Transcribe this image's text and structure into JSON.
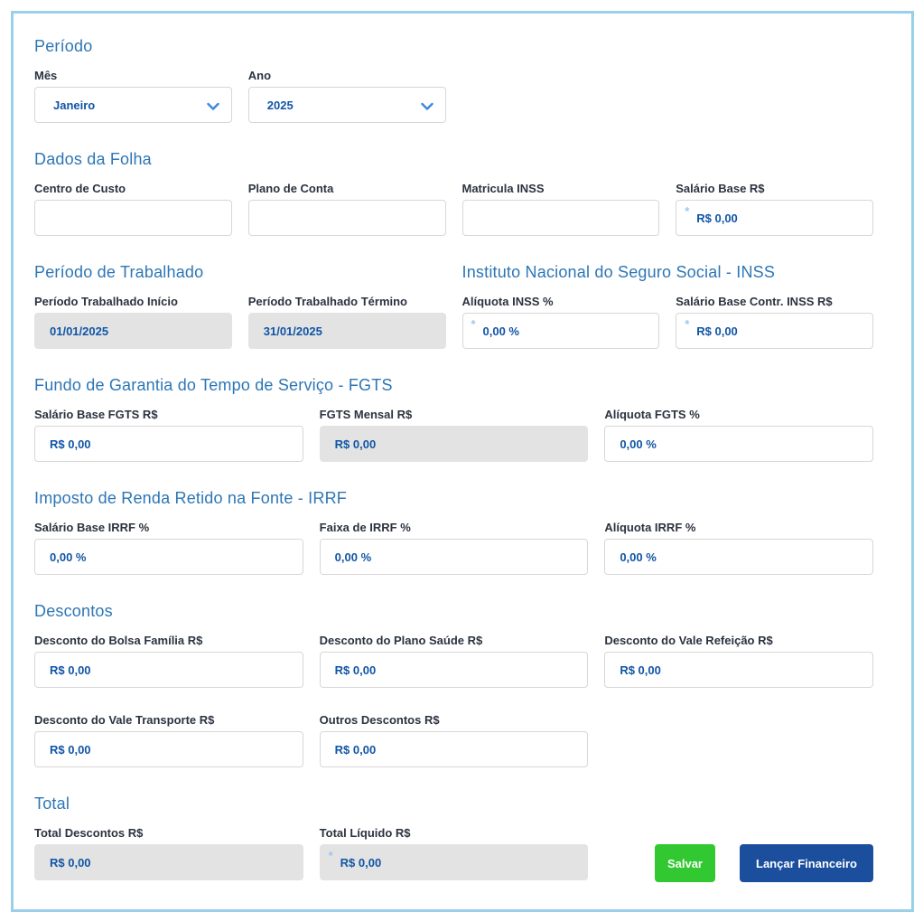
{
  "sections": {
    "periodo": {
      "title": "Período"
    },
    "dados_folha": {
      "title": "Dados da Folha"
    },
    "periodo_trabalhado": {
      "title": "Período de Trabalhado"
    },
    "inss": {
      "title": "Instituto Nacional do Seguro Social - INSS"
    },
    "fgts": {
      "title": "Fundo de Garantia do Tempo de Serviço - FGTS"
    },
    "irrf": {
      "title": "Imposto de Renda Retido na Fonte - IRRF"
    },
    "descontos": {
      "title": "Descontos"
    },
    "total": {
      "title": "Total"
    }
  },
  "fields": {
    "mes": {
      "label": "Mês",
      "value": "Janeiro"
    },
    "ano": {
      "label": "Ano",
      "value": "2025"
    },
    "centro_custo": {
      "label": "Centro de Custo",
      "value": ""
    },
    "plano_conta": {
      "label": "Plano de Conta",
      "value": ""
    },
    "matricula_inss": {
      "label": "Matricula INSS",
      "value": ""
    },
    "salario_base": {
      "label": "Salário Base R$",
      "value": "R$ 0,00",
      "required": "*"
    },
    "periodo_inicio": {
      "label": "Período Trabalhado Início",
      "value": "01/01/2025"
    },
    "periodo_termino": {
      "label": "Período Trabalhado Término",
      "value": "31/01/2025"
    },
    "aliquota_inss": {
      "label": "Alíquota INSS %",
      "value": "0,00 %",
      "required": "*"
    },
    "salario_base_contr_inss": {
      "label": "Salário Base Contr. INSS R$",
      "value": "R$ 0,00",
      "required": "*"
    },
    "salario_base_fgts": {
      "label": "Salário Base FGTS R$",
      "value": "R$ 0,00"
    },
    "fgts_mensal": {
      "label": "FGTS Mensal R$",
      "value": "R$ 0,00"
    },
    "aliquota_fgts": {
      "label": "Alíquota FGTS %",
      "value": "0,00 %"
    },
    "salario_base_irrf": {
      "label": "Salário Base IRRF %",
      "value": "0,00 %"
    },
    "faixa_irrf": {
      "label": "Faixa de IRRF %",
      "value": "0,00 %"
    },
    "aliquota_irrf": {
      "label": "Alíquota IRRF %",
      "value": "0,00 %"
    },
    "desconto_bolsa_familia": {
      "label": "Desconto do Bolsa Família R$",
      "value": "R$ 0,00"
    },
    "desconto_plano_saude": {
      "label": "Desconto do Plano Saúde R$",
      "value": "R$ 0,00"
    },
    "desconto_vale_refeicao": {
      "label": "Desconto do Vale Refeição R$",
      "value": "R$ 0,00"
    },
    "desconto_vale_transporte": {
      "label": "Desconto do Vale Transporte R$",
      "value": "R$ 0,00"
    },
    "outros_descontos": {
      "label": "Outros Descontos R$",
      "value": "R$ 0,00"
    },
    "total_descontos": {
      "label": "Total Descontos R$",
      "value": "R$ 0,00"
    },
    "total_liquido": {
      "label": "Total Líquido R$",
      "value": "R$ 0,00",
      "required": "*"
    }
  },
  "buttons": {
    "salvar": "Salvar",
    "lancar_financeiro": "Lançar Financeiro"
  },
  "colors": {
    "panel_border": "#9bcfea",
    "section_title": "#2d76b5",
    "label_text": "#2b3340",
    "value_text": "#1155a6",
    "required_star": "#9dc6ee",
    "chevron": "#3c87e0",
    "disabled_bg": "#e3e3e3",
    "save_button": "#31c831",
    "launch_button": "#1b4f9e"
  }
}
